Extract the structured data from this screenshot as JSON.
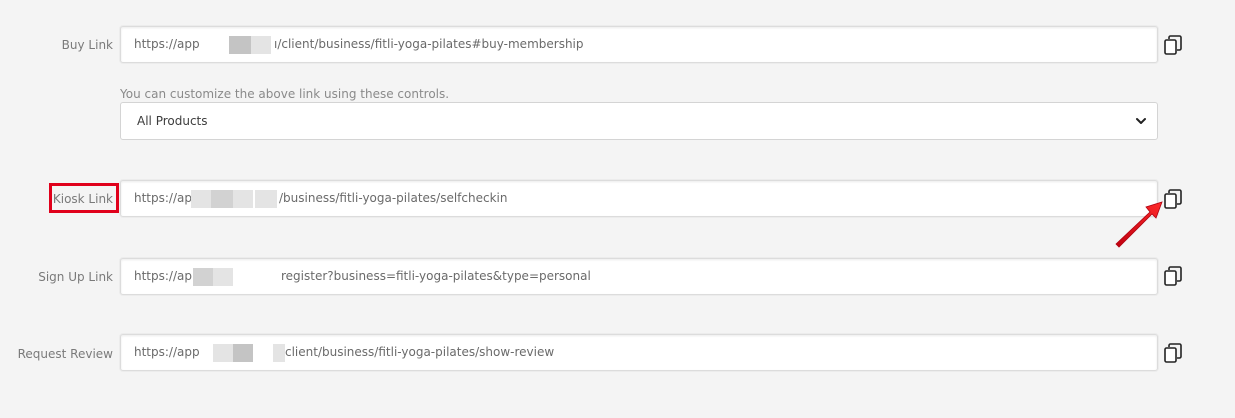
{
  "buy_link": {
    "label": "Buy Link",
    "prefix": "https://app",
    "suffix": "ı/client/business/fitli-yoga-pilates#buy-membership"
  },
  "customize": {
    "hint": "You can customize the above link using these controls.",
    "selected": "All Products"
  },
  "kiosk_link": {
    "label": "Kiosk Link",
    "prefix": "https://app",
    "suffix": "/business/fitli-yoga-pilates/selfcheckin"
  },
  "signup_link": {
    "label": "Sign Up Link",
    "prefix": "https://app",
    "suffix": "register?business=fitli-yoga-pilates&type=personal"
  },
  "review_link": {
    "label": "Request Review",
    "prefix": "https://app",
    "suffix": "client/business/fitli-yoga-pilates/show-review"
  },
  "icons": {
    "copy": "copy-icon",
    "chevron": "chevron-down-icon",
    "arrow": "annotation-arrow"
  },
  "colors": {
    "highlight": "#e0001b"
  }
}
